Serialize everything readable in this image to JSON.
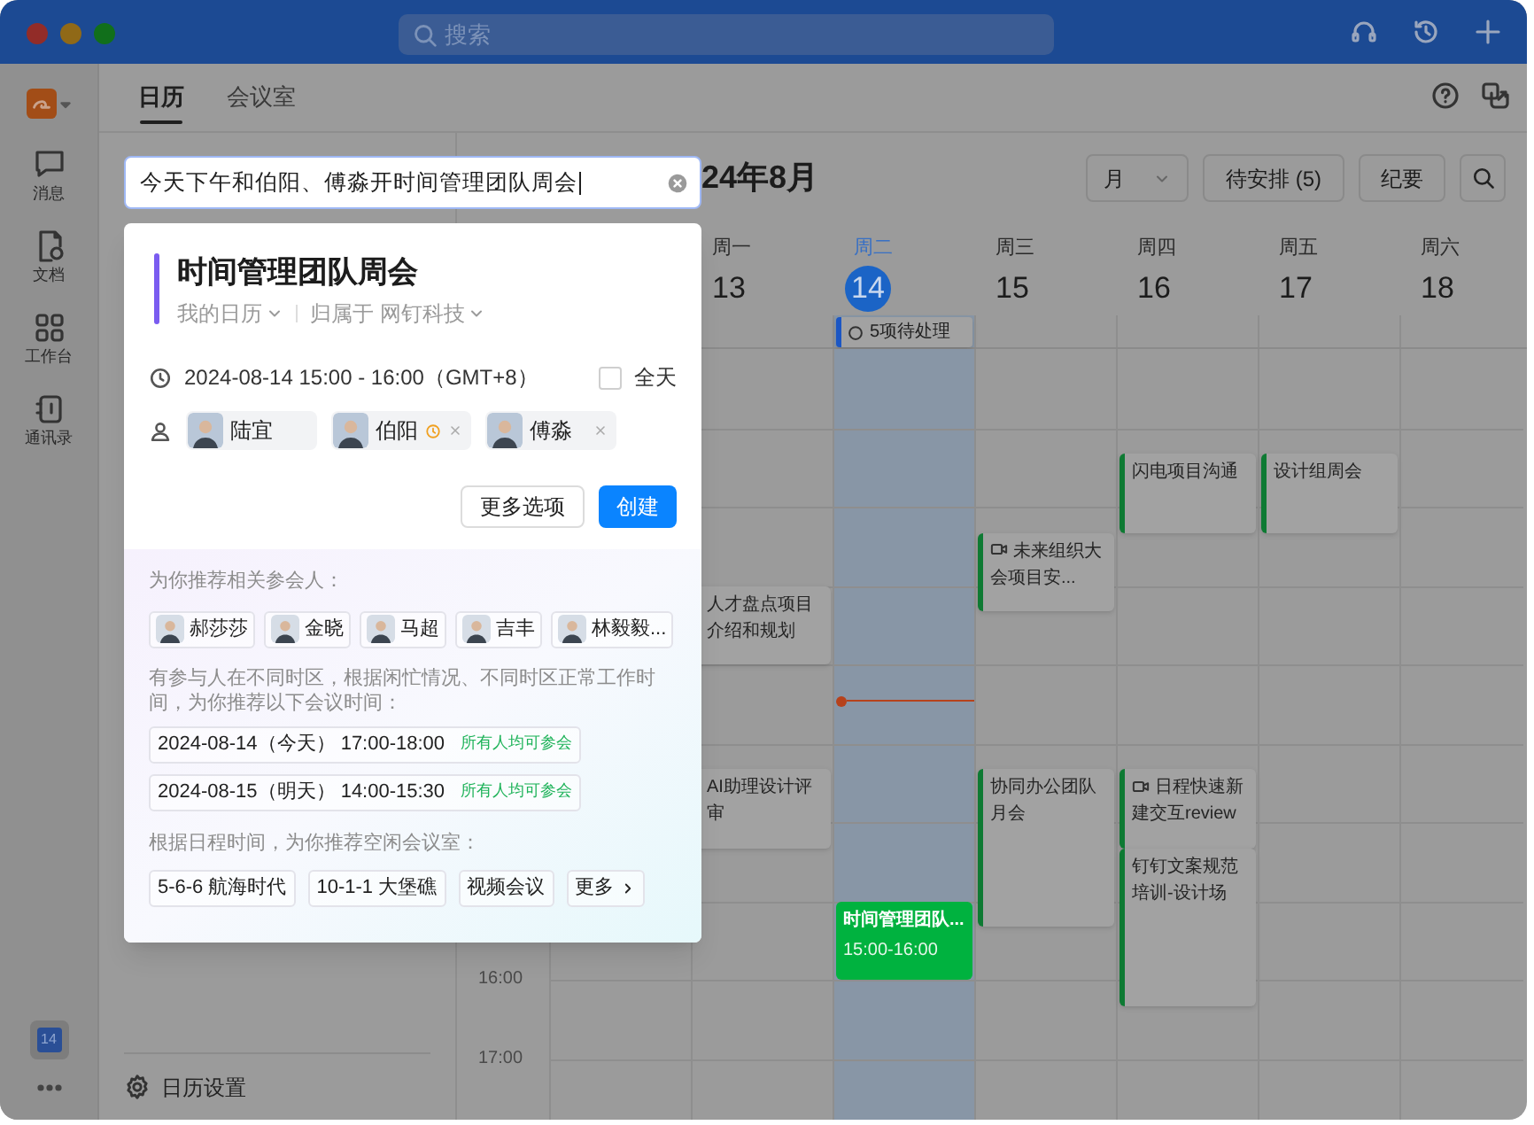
{
  "title_bar": {
    "search_placeholder": "搜索"
  },
  "sidebar": {
    "items": [
      {
        "label": "消息",
        "kind": "chat"
      },
      {
        "label": "文档",
        "kind": "doc"
      },
      {
        "label": "工作台",
        "kind": "apps"
      },
      {
        "label": "通讯录",
        "kind": "contacts"
      }
    ],
    "calendar_badge": "14"
  },
  "tabs": [
    {
      "label": "日历",
      "selected": true
    },
    {
      "label": "会议室",
      "selected": false
    }
  ],
  "settings_label": "日历设置",
  "calendar": {
    "title": "24年8月",
    "view": "月",
    "unscheduled": "待安排 (5)",
    "notes": "纪要",
    "days": [
      {
        "weekday": "周一",
        "date": "13",
        "selected": false,
        "events": [
          {
            "title": "人才盘点项目介绍和规划",
            "kind": "plain"
          },
          {
            "title": "AI助理设计评审",
            "kind": "plain"
          }
        ]
      },
      {
        "weekday": "周二",
        "date": "14",
        "selected": true,
        "all_day": [
          {
            "title": "5项待处理",
            "kind": "task"
          }
        ],
        "events": [
          {
            "title": "时间管理团队...",
            "kind": "new",
            "time": "15:00-16:00"
          }
        ]
      },
      {
        "weekday": "周三",
        "date": "15",
        "selected": false,
        "events": [
          {
            "title": "未来组织大会项目安...",
            "kind": "video"
          },
          {
            "title": "协同办公团队月会",
            "kind": "plain"
          }
        ]
      },
      {
        "weekday": "周四",
        "date": "16",
        "selected": false,
        "events": [
          {
            "title": "闪电项目沟通",
            "kind": "plain"
          },
          {
            "title": "日程快速新建交互review",
            "kind": "video"
          },
          {
            "title": "钉钉文案规范培训-设计场",
            "kind": "plain"
          }
        ]
      },
      {
        "weekday": "周五",
        "date": "17",
        "selected": false,
        "events": [
          {
            "title": "设计组周会",
            "kind": "plain"
          }
        ]
      },
      {
        "weekday": "周六",
        "date": "18",
        "selected": false
      }
    ],
    "time_labels": [
      "16:00",
      "17:00"
    ]
  },
  "quick_create": {
    "input_value": "今天下午和伯阳、傅淼开时间管理团队周会",
    "event_title": "时间管理团队周会",
    "calendar": "我的日历",
    "owner": "归属于 网钉科技",
    "time": "2024-08-14 15:00 - 16:00（GMT+8）",
    "all_day": {
      "label": "全天",
      "checked": false
    },
    "attendees": [
      {
        "name": "陆宜",
        "removable": false,
        "busy": false
      },
      {
        "name": "伯阳",
        "removable": true,
        "busy": true
      },
      {
        "name": "傅淼",
        "removable": true,
        "busy": false
      }
    ],
    "more_button": "更多选项",
    "create_button": "创建",
    "suggest_people_label": "为你推荐相关参会人：",
    "suggested_people": [
      "郝莎莎",
      "金晓",
      "马超",
      "吉丰",
      "林毅毅..."
    ],
    "suggest_time_label": "有参与人在不同时区，根据闲忙情况、不同时区正常工作时间，为你推荐以下会议时间：",
    "suggested_times": [
      {
        "time": "2024-08-14（今天） 17:00-18:00",
        "note": "所有人均可参会"
      },
      {
        "time": "2024-08-15（明天） 14:00-15:30",
        "note": "所有人均可参会"
      }
    ],
    "suggest_room_label": "根据日程时间，为你推荐空闲会议室：",
    "rooms": [
      "5-6-6 航海时代",
      "10-1-1 大堡礁",
      "视频会议"
    ],
    "more_rooms": "更多"
  }
}
